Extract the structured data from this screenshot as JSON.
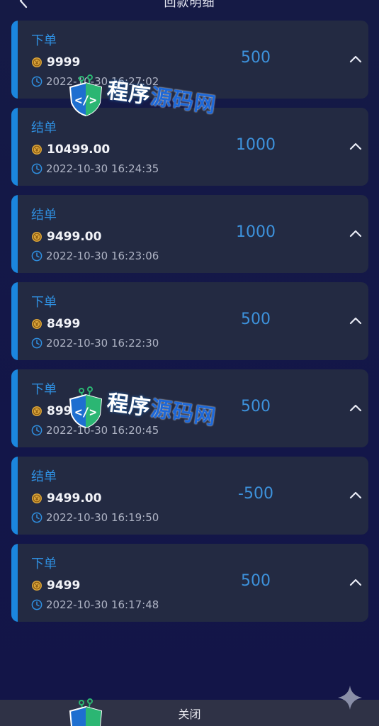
{
  "header": {
    "title": "回款明细",
    "back_icon": "chevron-left-icon"
  },
  "records": [
    {
      "type": "下单",
      "balance": "9999",
      "time": "2022-10-30 16:27:02",
      "amount": "500"
    },
    {
      "type": "结单",
      "balance": "10499.00",
      "time": "2022-10-30 16:24:35",
      "amount": "1000"
    },
    {
      "type": "结单",
      "balance": "9499.00",
      "time": "2022-10-30 16:23:06",
      "amount": "1000"
    },
    {
      "type": "下单",
      "balance": "8499",
      "time": "2022-10-30 16:22:30",
      "amount": "500"
    },
    {
      "type": "下单",
      "balance": "8999",
      "time": "2022-10-30 16:20:45",
      "amount": "500"
    },
    {
      "type": "结单",
      "balance": "9499.00",
      "time": "2022-10-30 16:19:50",
      "amount": "-500"
    },
    {
      "type": "下单",
      "balance": "9499",
      "time": "2022-10-30 16:17:48",
      "amount": "500"
    }
  ],
  "watermark": {
    "text_a": "程序",
    "text_b": "源码网"
  },
  "footer": {
    "close_label": "关闭"
  },
  "colors": {
    "background": "#131649",
    "card": "#232a42",
    "accent": "#1b86de",
    "type_text": "#2f8fe0",
    "amount_text": "#3d92dc",
    "coin": "#d9a43a"
  }
}
